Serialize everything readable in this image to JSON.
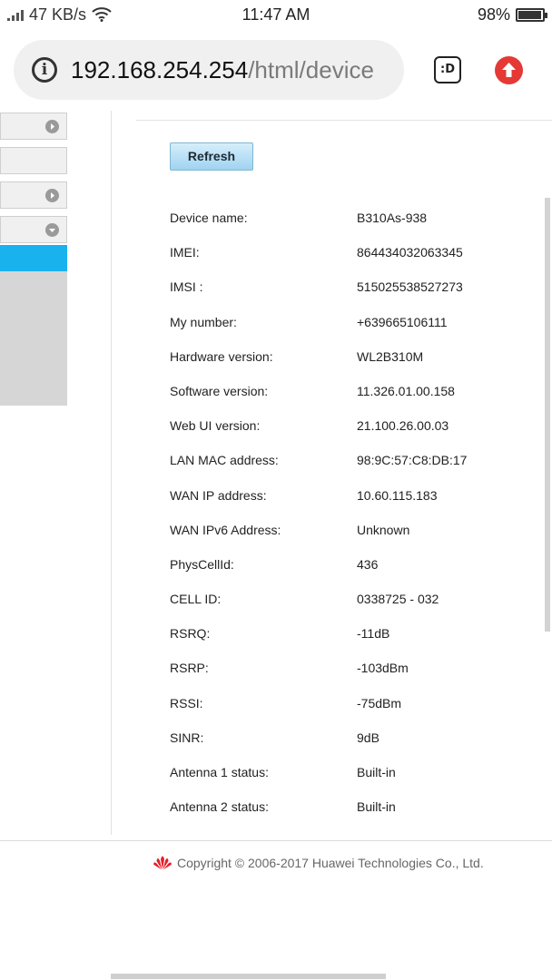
{
  "status_bar": {
    "network_speed": "47 KB/s",
    "time": "11:47 AM",
    "battery_percent": "98%",
    "battery_level": 0.98,
    "icons": [
      "signal-icon",
      "wifi-icon",
      "battery-icon"
    ]
  },
  "browser": {
    "url_host": "192.168.254.254",
    "url_path": "/html/device",
    "extension_label": ":D",
    "icons": [
      "info-icon",
      "extension-icon",
      "update-icon"
    ]
  },
  "main": {
    "refresh_label": "Refresh",
    "device_info": [
      {
        "label": "Device name:",
        "value": "B310As-938"
      },
      {
        "label": "IMEI:",
        "value": "864434032063345"
      },
      {
        "label": "IMSI :",
        "value": "515025538527273"
      },
      {
        "label": "My number:",
        "value": "+639665106111"
      },
      {
        "label": "Hardware version:",
        "value": "WL2B310M"
      },
      {
        "label": "Software version:",
        "value": "11.326.01.00.158"
      },
      {
        "label": "Web UI version:",
        "value": "21.100.26.00.03"
      },
      {
        "label": "LAN MAC address:",
        "value": "98:9C:57:C8:DB:17"
      },
      {
        "label": "WAN IP address:",
        "value": "10.60.115.183"
      },
      {
        "label": "WAN IPv6 Address:",
        "value": "Unknown"
      },
      {
        "label": "PhysCellId:",
        "value": "436"
      },
      {
        "label": "CELL ID:",
        "value": "0338725 - 032"
      },
      {
        "label": "RSRQ:",
        "value": "-11dB"
      },
      {
        "label": "RSRP:",
        "value": "-103dBm"
      },
      {
        "label": "RSSI:",
        "value": "-75dBm"
      },
      {
        "label": "SINR:",
        "value": "9dB"
      },
      {
        "label": "Antenna 1 status:",
        "value": "Built-in"
      },
      {
        "label": "Antenna 2 status:",
        "value": "Built-in"
      }
    ]
  },
  "footer": {
    "copyright": "Copyright © 2006-2017 Huawei Technologies Co., Ltd.",
    "logo_icon": "huawei-logo-icon"
  },
  "colors": {
    "active_nav": "#1ab2ee",
    "update_badge": "#e53935",
    "huawei_red": "#e41f2b"
  }
}
